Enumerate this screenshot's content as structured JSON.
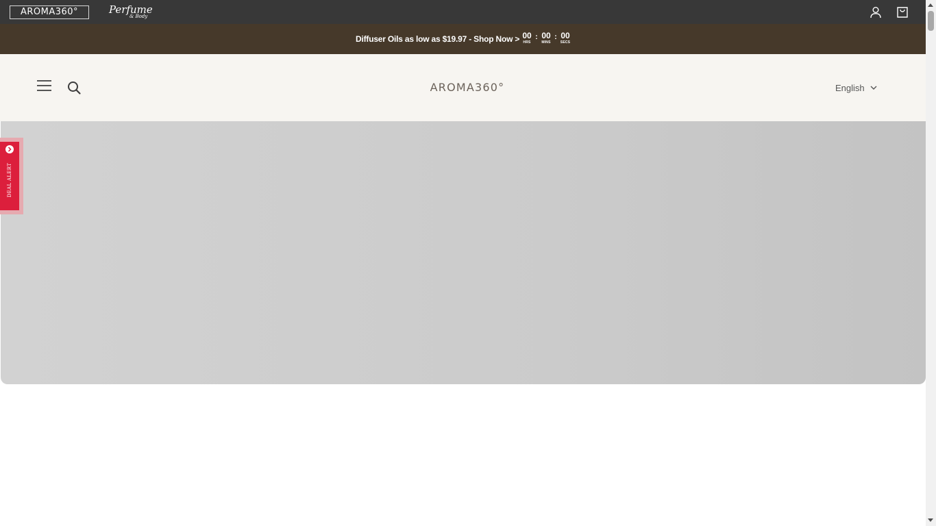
{
  "top_bar": {
    "brand": "AROMA360°",
    "perfume_logo": {
      "main": "Perfume",
      "sub": "& Body"
    },
    "account_icon": "user-icon",
    "cart_icon": "shopping-bag-icon"
  },
  "promo": {
    "text": "Diffuser Oils as low as $19.97 - Shop Now >",
    "countdown": {
      "hours": "00",
      "hours_label": "HRS",
      "separator": ":",
      "minutes": "00",
      "minutes_label": "MINS",
      "seconds": "00",
      "seconds_label": "SECS"
    }
  },
  "header": {
    "menu_icon": "hamburger-menu-icon",
    "search_icon": "search-icon",
    "logo": "AROMA360°",
    "language": "English"
  },
  "deal_alert": {
    "label": "DEAL ALERT"
  },
  "colors": {
    "top_bar_bg": "#383838",
    "promo_bg": "#46392a",
    "header_bg": "#f7f5f1",
    "deal_red": "#dc1f3c"
  }
}
